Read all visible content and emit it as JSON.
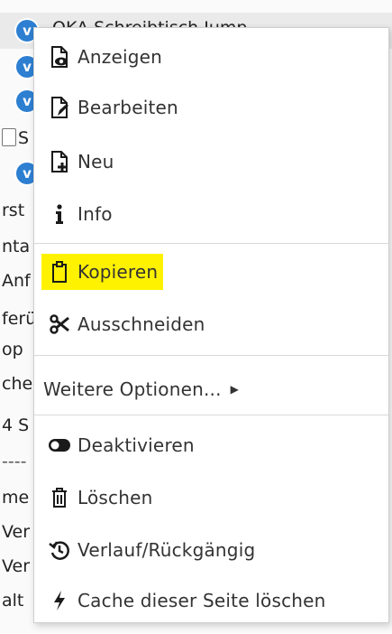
{
  "tree": {
    "rows": [
      {
        "text": "OKA Schreibtisch Jump",
        "badge": "V"
      },
      {
        "text": "",
        "badge": "V"
      },
      {
        "text": "",
        "badge": "V"
      },
      {
        "text": "S",
        "doc": true
      },
      {
        "text": "",
        "badge": "V"
      },
      {
        "text": "rst"
      },
      {
        "text": "nta"
      },
      {
        "text": "Anf"
      },
      {
        "text": "ferü"
      },
      {
        "text": "op"
      },
      {
        "text": "che"
      },
      {
        "text": "4 S"
      },
      {
        "text": "----"
      },
      {
        "text": "me"
      },
      {
        "text": "Ver"
      },
      {
        "text": "Ver"
      },
      {
        "text": "alt"
      }
    ]
  },
  "menu": {
    "items": {
      "show": {
        "label": "Anzeigen",
        "icon": "eye-document-icon"
      },
      "edit": {
        "label": "Bearbeiten",
        "icon": "pencil-document-icon"
      },
      "new": {
        "label": "Neu",
        "icon": "plus-document-icon"
      },
      "info": {
        "label": "Info",
        "icon": "info-icon"
      },
      "copy": {
        "label": "Kopieren",
        "icon": "clipboard-icon"
      },
      "cut": {
        "label": "Ausschneiden",
        "icon": "scissors-icon"
      },
      "more": {
        "label": "Weitere Optionen...",
        "icon": "caret-right-icon"
      },
      "deactivate": {
        "label": "Deaktivieren",
        "icon": "toggle-icon"
      },
      "delete": {
        "label": "Löschen",
        "icon": "trash-icon"
      },
      "history": {
        "label": "Verlauf/Rückgängig",
        "icon": "history-icon"
      },
      "clear_cache": {
        "label": "Cache dieser Seite löschen",
        "icon": "lightning-icon"
      }
    }
  },
  "colors": {
    "highlight": "#fff200",
    "badge": "#2d7fd1"
  }
}
